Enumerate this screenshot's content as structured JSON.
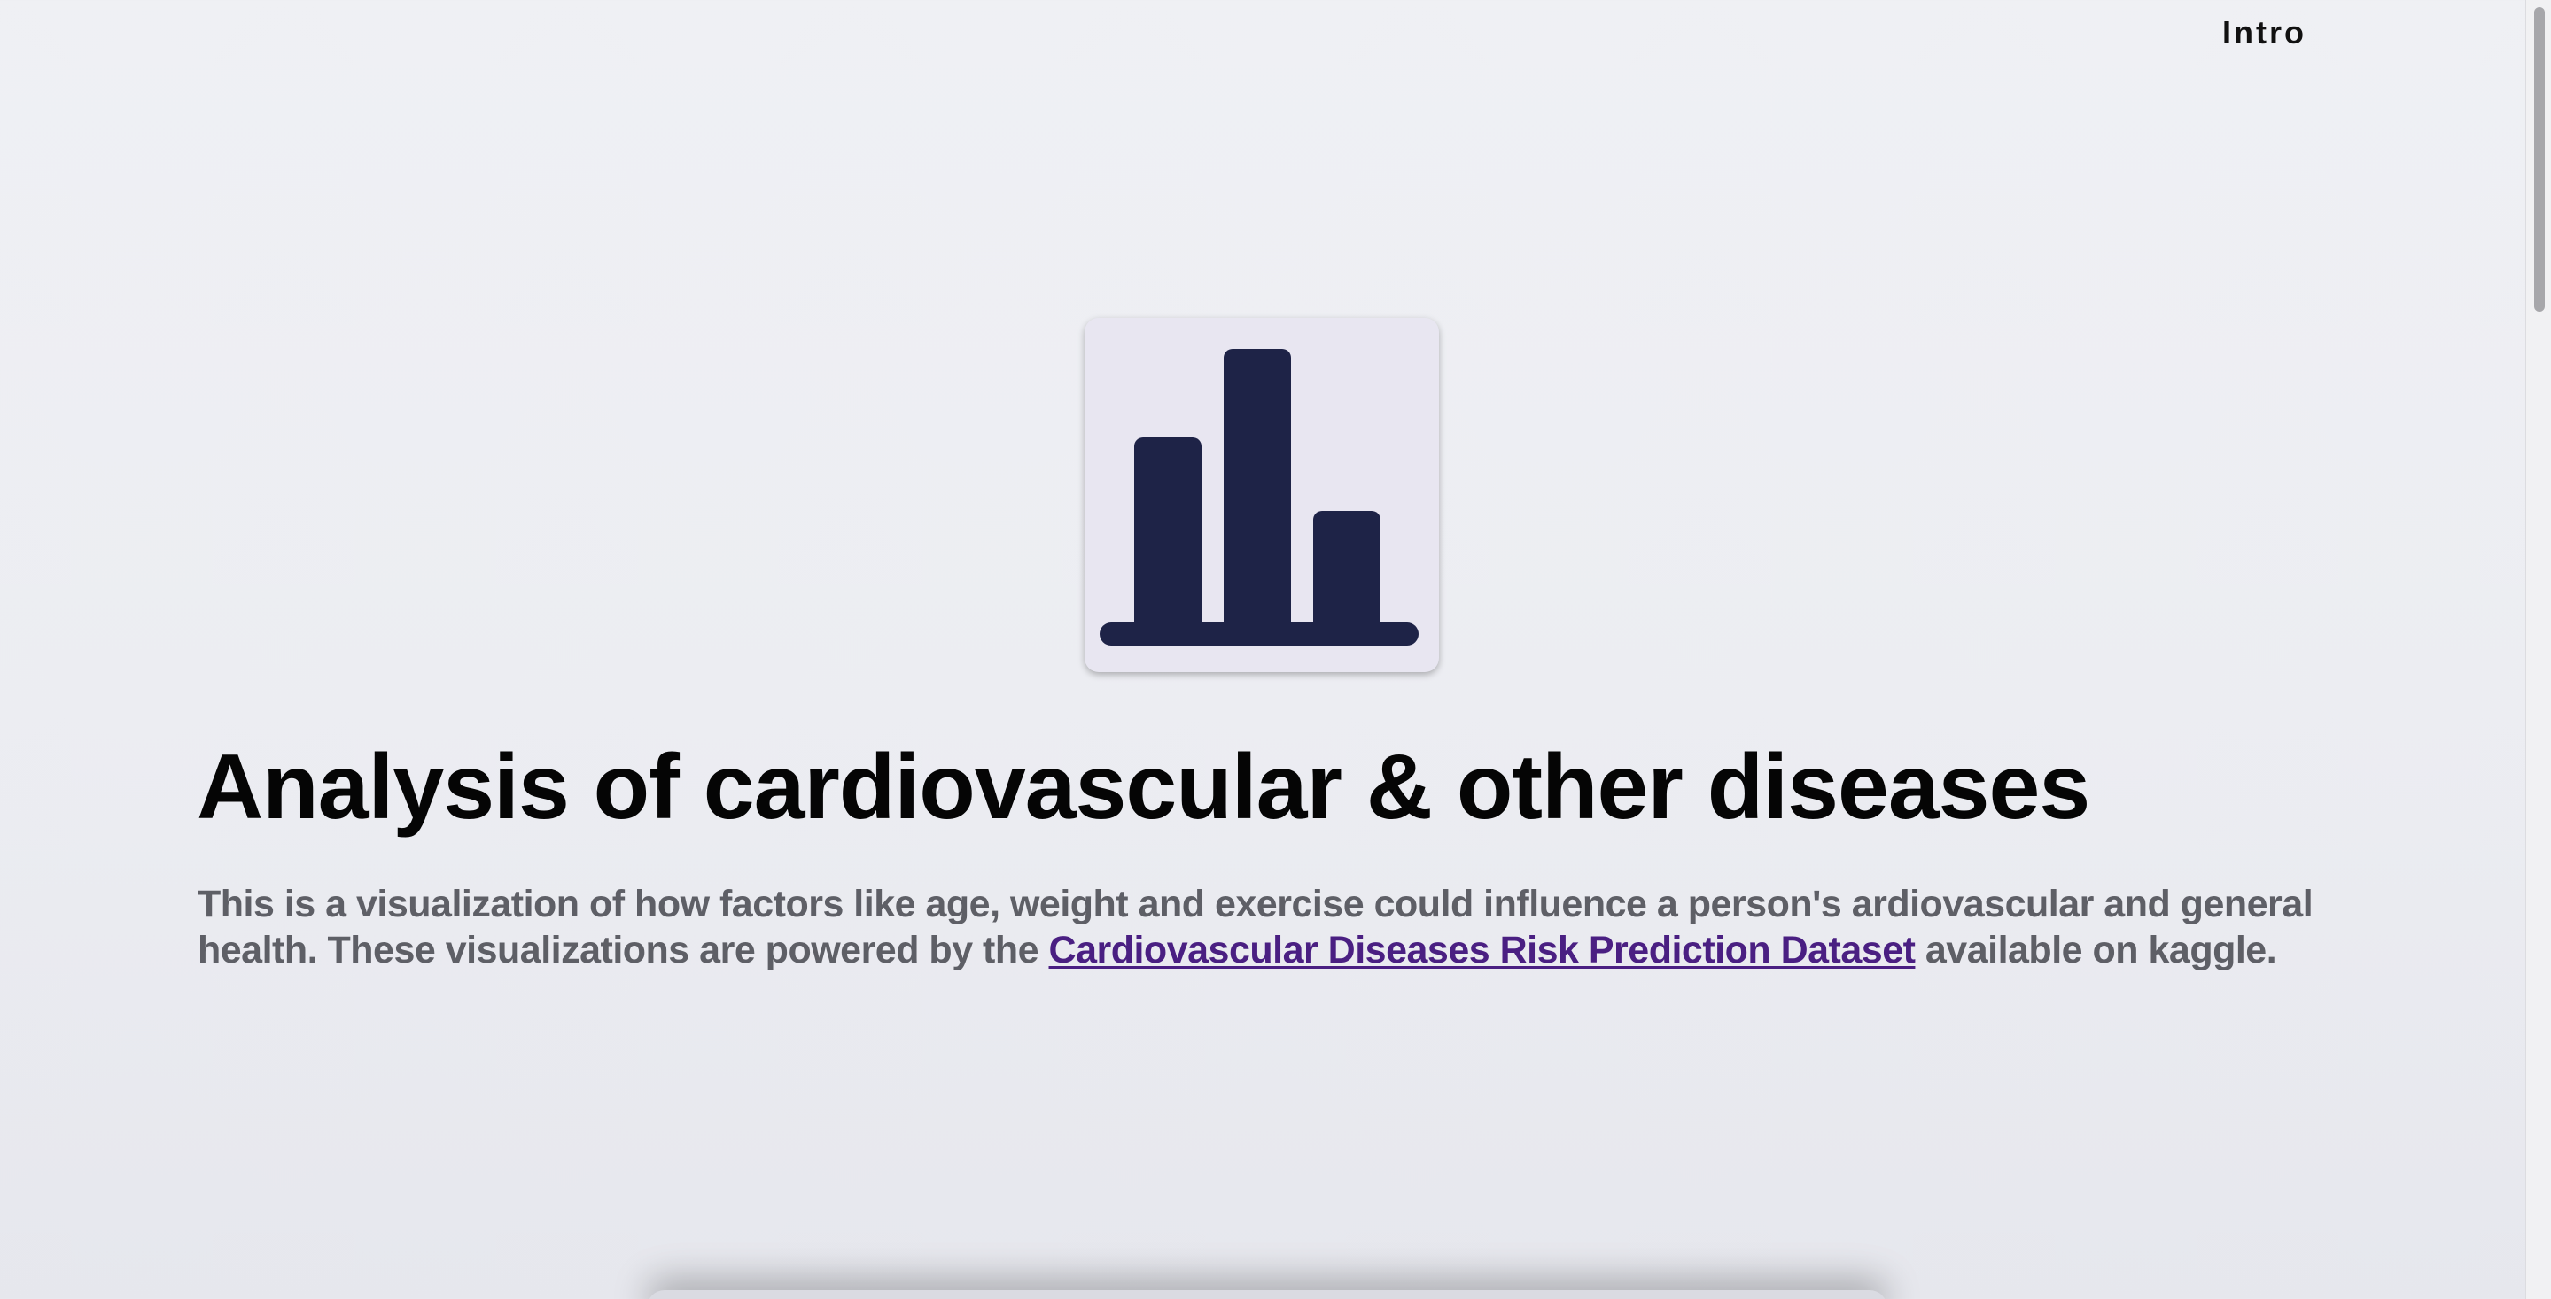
{
  "nav": {
    "intro_label": "Intro"
  },
  "logo": {
    "icon": "bar-chart-icon",
    "card_color": "#e8e6f1",
    "bar_color": "#1e2347"
  },
  "hero": {
    "title": "Analysis of cardiovascular & other diseases",
    "text_before": "This is a visualization of how factors like age, weight and exercise could influence a person's ardiovascular and general health. These visualizations are powered by the ",
    "link_text": "Cardiovascular Diseases Risk Prediction Dataset",
    "text_after": " available on kaggle."
  },
  "colors": {
    "link": "#4a1f82",
    "body_text": "#5e5f66",
    "title": "#050505"
  }
}
